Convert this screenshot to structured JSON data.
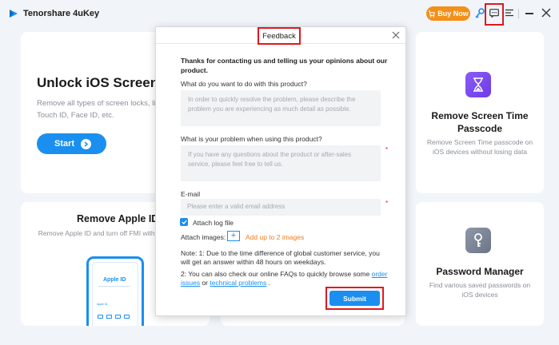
{
  "app": {
    "title": "Tenorshare 4uKey",
    "buy_now_label": "Buy Now"
  },
  "cards": {
    "unlock": {
      "title": "Unlock iOS Screen",
      "description": "Remove all types of screen locks, lik passcode, Touch ID, Face ID, etc.",
      "start_label": "Start"
    },
    "apple_id": {
      "title": "Remove Apple ID",
      "description": "Remove Apple ID and turn off FMI without p iOS devices",
      "phone_title": "Apple ID",
      "phone_small": "Apple ID"
    },
    "screen_time": {
      "title": "Remove Screen Time Passcode",
      "description": "Remove Screen Time passcode on iOS devices without losing data"
    },
    "password": {
      "title": "Password Manager",
      "description": "Find various saved passwords on iOS devices"
    }
  },
  "dialog": {
    "title": "Feedback",
    "intro": "Thanks for contacting us and telling us your opinions about our product.",
    "question1": "What do you want to do with this product?",
    "question1_placeholder": "In order to quickly resolve the problem, please describe the problem you are experiencing as much detail as possible.",
    "question2": "What is your problem when using this product?",
    "question2_placeholder": "If you have any questions about the product or after-sales service, please feel free to tell us.",
    "required_mark": "*",
    "email_label": "E-mail",
    "email_placeholder": "Please enter a valid email address",
    "attach_log_label": "Attach log file",
    "attach_log_checked": true,
    "attach_images_label": "Attach images:",
    "add_images_symbol": "+",
    "add_images_hint": "Add up to 2 images",
    "note1": "Note: 1: Due to the time difference of global customer service, you will get an answer within 48 hours on weekdays.",
    "note2_prefix": "2: You can also check our online FAQs to quickly browse some ",
    "note2_link1": "order issues",
    "note2_middle": " or ",
    "note2_link2": "technical problems",
    "note2_suffix": " .",
    "submit_label": "Submit"
  },
  "colors": {
    "accent": "#1a8ff0",
    "buy": "#f39019",
    "highlight_border": "#e0181f",
    "hint_orange": "#f07d1e"
  }
}
